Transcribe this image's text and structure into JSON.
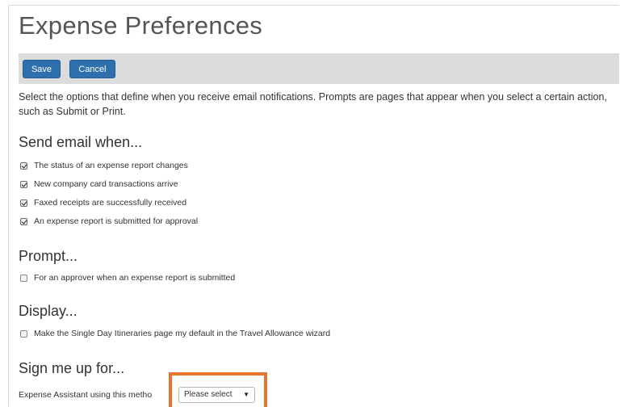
{
  "page_title": "Expense Preferences",
  "toolbar": {
    "save_label": "Save",
    "cancel_label": "Cancel"
  },
  "intro": "Select the options that define when you receive email notifications. Prompts are pages that appear when you select a certain action, such as Submit or Print.",
  "send_email": {
    "heading": "Send email when...",
    "options": [
      {
        "label": "The status of an expense report changes",
        "checked": true
      },
      {
        "label": "New company card transactions arrive",
        "checked": true
      },
      {
        "label": "Faxed receipts are successfully received",
        "checked": true
      },
      {
        "label": "An expense report is submitted for approval",
        "checked": true
      }
    ]
  },
  "prompt": {
    "heading": "Prompt...",
    "options": [
      {
        "label": "For an approver when an expense report is submitted",
        "checked": false
      }
    ]
  },
  "display": {
    "heading": "Display...",
    "options": [
      {
        "label": "Make the Single Day Itineraries page my default in the Travel Allowance wizard",
        "checked": false
      }
    ]
  },
  "signup": {
    "heading": "Sign me up for...",
    "label": "Expense Assistant using this metho",
    "select_value": "Please select",
    "caret": "▼"
  },
  "colors": {
    "button_blue": "#2f6fad",
    "toolbar_gray": "#dcdcdc",
    "highlight_orange": "#e8742c"
  }
}
